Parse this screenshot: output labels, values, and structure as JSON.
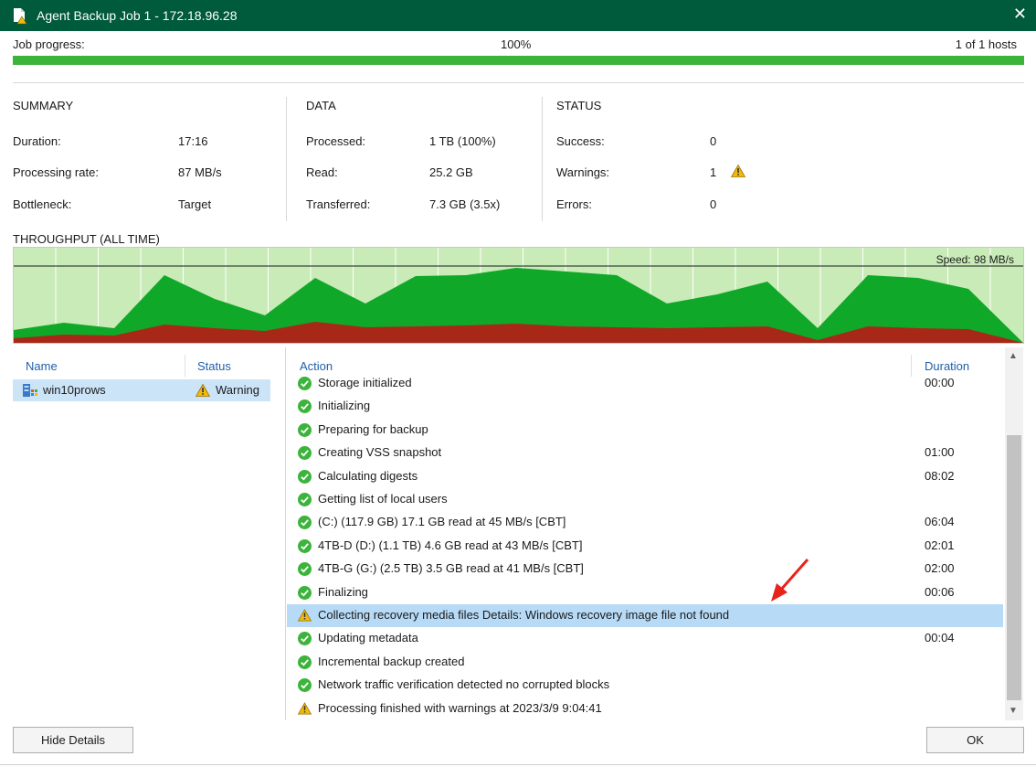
{
  "window": {
    "title": "Agent Backup Job 1 - 172.18.96.28",
    "close_glyph": "✕"
  },
  "progress": {
    "label": "Job progress:",
    "percent_text": "100%",
    "hosts_text": "1 of 1 hosts",
    "fraction": 1.0
  },
  "summary": {
    "header": "SUMMARY",
    "rows": [
      {
        "label": "Duration:",
        "value": "17:16"
      },
      {
        "label": "Processing rate:",
        "value": "87 MB/s"
      },
      {
        "label": "Bottleneck:",
        "value": "Target"
      }
    ]
  },
  "data_section": {
    "header": "DATA",
    "rows": [
      {
        "label": "Processed:",
        "value": "1 TB (100%)"
      },
      {
        "label": "Read:",
        "value": "25.2 GB"
      },
      {
        "label": "Transferred:",
        "value": "7.3 GB (3.5x)"
      }
    ]
  },
  "status_section": {
    "header": "STATUS",
    "rows": [
      {
        "label": "Success:",
        "value": "0"
      },
      {
        "label": "Warnings:",
        "value": "1"
      },
      {
        "label": "Errors:",
        "value": "0"
      }
    ]
  },
  "throughput": {
    "title": "THROUGHPUT (ALL TIME)",
    "speed_label": "Speed: 98 MB/s"
  },
  "vm_list": {
    "col_name": "Name",
    "col_status": "Status",
    "rows": [
      {
        "name": "win10prows",
        "status": "Warning"
      }
    ]
  },
  "actions": {
    "col_action": "Action",
    "col_duration": "Duration",
    "rows": [
      {
        "icon": "success",
        "text": "Storage initialized",
        "duration": "00:00"
      },
      {
        "icon": "success",
        "text": "Initializing",
        "duration": ""
      },
      {
        "icon": "success",
        "text": "Preparing for backup",
        "duration": ""
      },
      {
        "icon": "success",
        "text": "Creating VSS snapshot",
        "duration": "01:00"
      },
      {
        "icon": "success",
        "text": "Calculating digests",
        "duration": "08:02"
      },
      {
        "icon": "success",
        "text": "Getting list of local users",
        "duration": ""
      },
      {
        "icon": "success",
        "text": "(C:) (117.9 GB) 17.1 GB read at 45 MB/s [CBT]",
        "duration": "06:04"
      },
      {
        "icon": "success",
        "text": "4TB-D (D:) (1.1 TB) 4.6 GB read at 43 MB/s [CBT]",
        "duration": "02:01"
      },
      {
        "icon": "success",
        "text": "4TB-G (G:) (2.5 TB) 3.5 GB read at 41 MB/s [CBT]",
        "duration": "02:00"
      },
      {
        "icon": "success",
        "text": "Finalizing",
        "duration": "00:06"
      },
      {
        "icon": "warning",
        "text": "Collecting recovery media files Details: Windows recovery image file not found",
        "duration": "",
        "highlighted": true
      },
      {
        "icon": "success",
        "text": "Updating metadata",
        "duration": "00:04"
      },
      {
        "icon": "success",
        "text": "Incremental backup created",
        "duration": ""
      },
      {
        "icon": "success",
        "text": "Network traffic verification detected no corrupted blocks",
        "duration": ""
      },
      {
        "icon": "warning",
        "text": "Processing finished with warnings at 2023/3/9 9:04:41",
        "duration": ""
      }
    ]
  },
  "buttons": {
    "hide_details": "Hide Details",
    "ok": "OK"
  },
  "colors": {
    "titlebar": "#005a3c",
    "progress": "#3cb43c",
    "chart_green": "#10a828",
    "chart_red": "#a82818",
    "chart_bg": "#c8ebb8",
    "highlight": "#b7dbf7",
    "link_blue": "#1f5fa8"
  }
}
